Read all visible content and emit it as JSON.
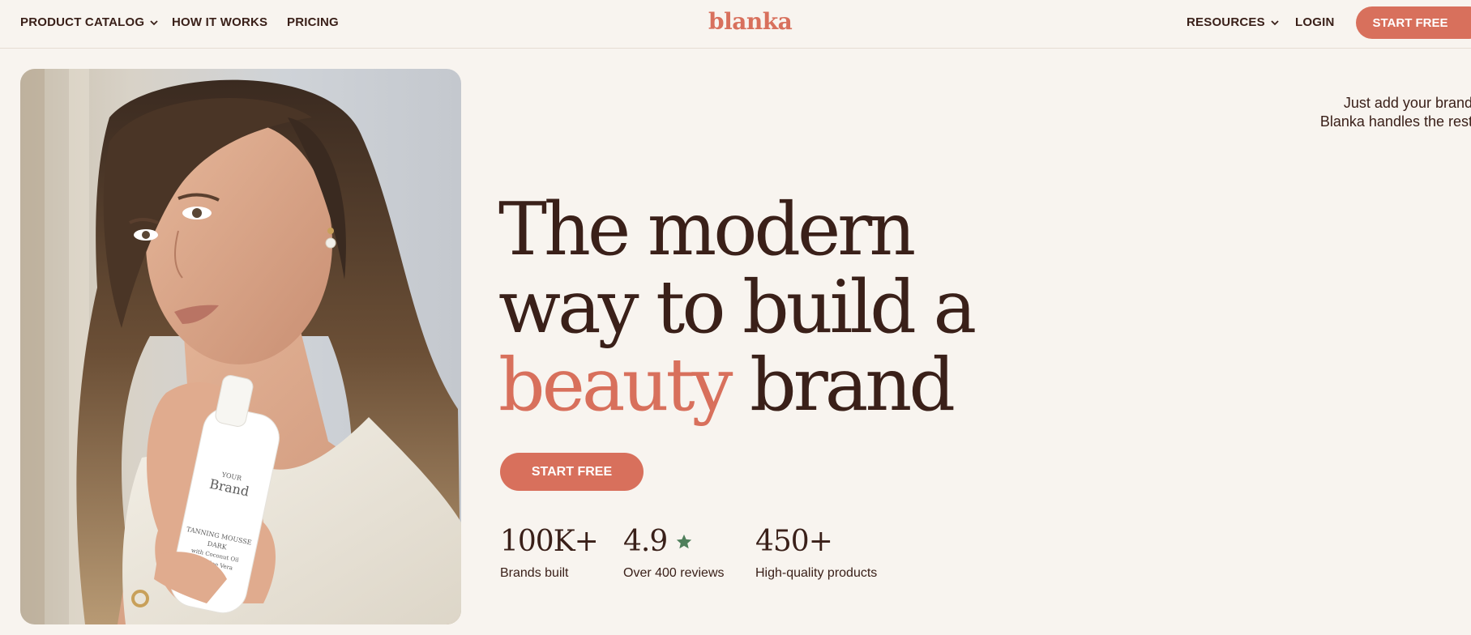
{
  "nav": {
    "product_catalog": "PRODUCT CATALOG",
    "how_it_works": "HOW IT WORKS",
    "pricing": "PRICING",
    "logo": "blanka",
    "resources": "RESOURCES",
    "login": "LOGIN",
    "start_free": "START FREE"
  },
  "hero": {
    "tagline_line1": "Just add your brand",
    "tagline_line2": "Blanka handles the rest",
    "headline_line1": "The modern",
    "headline_line2": "way to build a",
    "headline_accent": "beauty",
    "headline_line3_rest": " brand",
    "cta": "START FREE",
    "product_label": {
      "your": "YOUR",
      "brand": "Brand",
      "line1": "TANNING MOUSSE",
      "line2": "DARK",
      "line3": "with Coconut Oil",
      "line4": "and Aloe Vera"
    }
  },
  "stats": [
    {
      "value": "100K+",
      "label": "Brands built"
    },
    {
      "value": "4.9",
      "label": "Over 400 reviews",
      "icon": "star-icon"
    },
    {
      "value": "450+",
      "label": "High-quality products"
    }
  ],
  "colors": {
    "accent": "#d8705c",
    "text": "#3a2019",
    "background": "#f8f4ef",
    "star": "#4f7f5b"
  }
}
